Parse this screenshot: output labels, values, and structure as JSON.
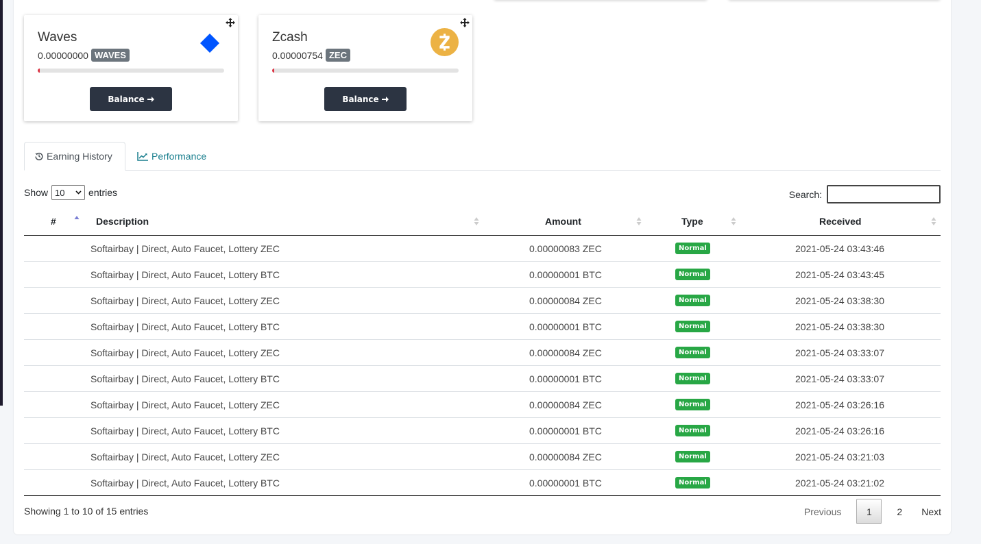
{
  "cards": [
    {
      "name": "Waves",
      "amount": "0.00000000",
      "symbol": "WAVES",
      "progress_percent": 1,
      "button_label": "Balance",
      "icon": "waves-diamond-icon",
      "icon_color": "#0055ff"
    },
    {
      "name": "Zcash",
      "amount": "0.00000754",
      "symbol": "ZEC",
      "progress_percent": 1,
      "button_label": "Balance",
      "icon": "zcash-coin-icon",
      "icon_color": "#ecb244"
    }
  ],
  "tabs": [
    {
      "label": "Earning History",
      "icon": "history-icon",
      "active": true
    },
    {
      "label": "Performance",
      "icon": "line-chart-icon",
      "active": false
    }
  ],
  "table_controls": {
    "show_label": "Show",
    "entries_value": "10",
    "entries_label": "entries",
    "search_label": "Search:",
    "search_value": ""
  },
  "table": {
    "columns": [
      "#",
      "Description",
      "Amount",
      "Type",
      "Received"
    ],
    "rows": [
      {
        "num": "",
        "description": "Softairbay | Direct, Auto Faucet, Lottery ZEC",
        "amount": "0.00000083 ZEC",
        "type": "Normal",
        "received": "2021-05-24 03:43:46"
      },
      {
        "num": "",
        "description": "Softairbay | Direct, Auto Faucet, Lottery BTC",
        "amount": "0.00000001 BTC",
        "type": "Normal",
        "received": "2021-05-24 03:43:45"
      },
      {
        "num": "",
        "description": "Softairbay | Direct, Auto Faucet, Lottery ZEC",
        "amount": "0.00000084 ZEC",
        "type": "Normal",
        "received": "2021-05-24 03:38:30"
      },
      {
        "num": "",
        "description": "Softairbay | Direct, Auto Faucet, Lottery BTC",
        "amount": "0.00000001 BTC",
        "type": "Normal",
        "received": "2021-05-24 03:38:30"
      },
      {
        "num": "",
        "description": "Softairbay | Direct, Auto Faucet, Lottery ZEC",
        "amount": "0.00000084 ZEC",
        "type": "Normal",
        "received": "2021-05-24 03:33:07"
      },
      {
        "num": "",
        "description": "Softairbay | Direct, Auto Faucet, Lottery BTC",
        "amount": "0.00000001 BTC",
        "type": "Normal",
        "received": "2021-05-24 03:33:07"
      },
      {
        "num": "",
        "description": "Softairbay | Direct, Auto Faucet, Lottery ZEC",
        "amount": "0.00000084 ZEC",
        "type": "Normal",
        "received": "2021-05-24 03:26:16"
      },
      {
        "num": "",
        "description": "Softairbay | Direct, Auto Faucet, Lottery BTC",
        "amount": "0.00000001 BTC",
        "type": "Normal",
        "received": "2021-05-24 03:26:16"
      },
      {
        "num": "",
        "description": "Softairbay | Direct, Auto Faucet, Lottery ZEC",
        "amount": "0.00000084 ZEC",
        "type": "Normal",
        "received": "2021-05-24 03:21:03"
      },
      {
        "num": "",
        "description": "Softairbay | Direct, Auto Faucet, Lottery BTC",
        "amount": "0.00000001 BTC",
        "type": "Normal",
        "received": "2021-05-24 03:21:02"
      }
    ]
  },
  "footer": {
    "info": "Showing 1 to 10 of 15 entries",
    "previous": "Previous",
    "pages": [
      "1",
      "2"
    ],
    "next": "Next"
  },
  "colors": {
    "button_dark": "#2c3442",
    "badge_green": "#28a745",
    "badge_gray": "#6c757d",
    "tab_link": "#1a7f8e"
  }
}
